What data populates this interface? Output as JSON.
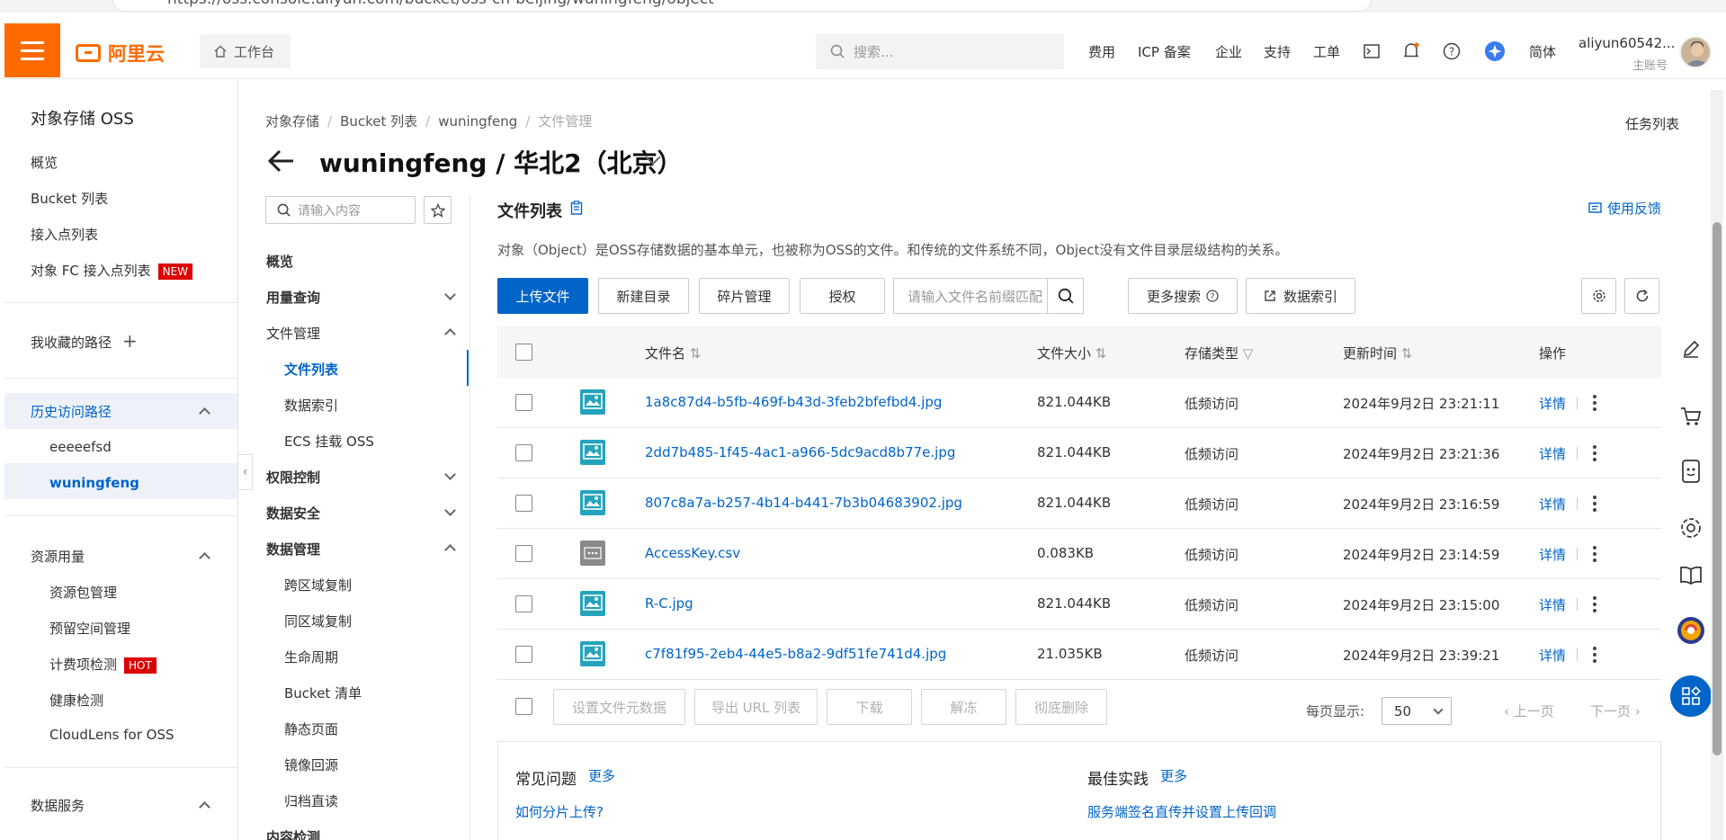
{
  "browser": {
    "url": "https://oss.console.aliyun.com/bucket/oss-cn-beijing/wuningfeng/object"
  },
  "header": {
    "logo_text": "阿里云",
    "workbench": "工作台",
    "search_placeholder": "搜索...",
    "nav": [
      "费用",
      "ICP 备案",
      "企业",
      "支持",
      "工单"
    ],
    "lang": "简体",
    "account": "aliyun60542...",
    "account_sub": "主账号"
  },
  "sidebar": {
    "title": "对象存储 OSS",
    "items": [
      "概览",
      "Bucket 列表",
      "接入点列表",
      "对象 FC 接入点列表"
    ],
    "fc_badge": "NEW",
    "favorites": "我收藏的路径",
    "history": {
      "label": "历史访问路径",
      "items": [
        "eeeeefsd",
        "wuningfeng"
      ]
    },
    "resource": {
      "label": "资源用量",
      "items": [
        "资源包管理",
        "预留空间管理",
        "计费项检测",
        "健康检测",
        "CloudLens for OSS"
      ],
      "hot_badge": "HOT"
    },
    "data_service": "数据服务"
  },
  "breadcrumb": [
    "对象存储",
    "Bucket 列表",
    "wuningfeng",
    "文件管理"
  ],
  "task_list": "任务列表",
  "page_title": "wuningfeng / 华北2（北京）",
  "secondary_nav": {
    "search_placeholder": "请输入内容",
    "overview": "概览",
    "usage": "用量查询",
    "file_mgmt": "文件管理",
    "file_sub": [
      "文件列表",
      "数据索引",
      "ECS 挂载 OSS"
    ],
    "perm": "权限控制",
    "security": "数据安全",
    "data_mgmt": "数据管理",
    "data_sub": [
      "跨区域复制",
      "同区域复制",
      "生命周期",
      "Bucket 清单",
      "静态页面",
      "镜像回源",
      "归档直读"
    ],
    "content": "内容检测"
  },
  "main": {
    "title": "文件列表",
    "feedback": "使用反馈",
    "description": "对象（Object）是OSS存储数据的基本单元，也被称为OSS的文件。和传统的文件系统不同，Object没有文件目录层级结构的关系。",
    "buttons": {
      "upload": "上传文件",
      "new_dir": "新建目录",
      "fragments": "碎片管理",
      "auth": "授权",
      "more_search": "更多搜索",
      "data_index": "数据索引"
    },
    "file_search_placeholder": "请输入文件名前缀匹配",
    "columns": [
      "文件名",
      "文件大小",
      "存储类型",
      "更新时间",
      "操作"
    ],
    "rows": [
      {
        "name": "1a8c87d4-b5fb-469f-b43d-3feb2bfefbd4.jpg",
        "size": "821.044KB",
        "type": "低频访问",
        "time": "2024年9月2日 23:21:11",
        "action": "详情",
        "kind": "img"
      },
      {
        "name": "2dd7b485-1f45-4ac1-a966-5dc9acd8b77e.jpg",
        "size": "821.044KB",
        "type": "低频访问",
        "time": "2024年9月2日 23:21:36",
        "action": "详情",
        "kind": "img"
      },
      {
        "name": "807c8a7a-b257-4b14-b441-7b3b04683902.jpg",
        "size": "821.044KB",
        "type": "低频访问",
        "time": "2024年9月2日 23:16:59",
        "action": "详情",
        "kind": "img"
      },
      {
        "name": "AccessKey.csv",
        "size": "0.083KB",
        "type": "低频访问",
        "time": "2024年9月2日 23:14:59",
        "action": "详情",
        "kind": "csv"
      },
      {
        "name": "R-C.jpg",
        "size": "821.044KB",
        "type": "低频访问",
        "time": "2024年9月2日 23:15:00",
        "action": "详情",
        "kind": "img"
      },
      {
        "name": "c7f81f95-2eb4-44e5-b8a2-9df51fe741d4.jpg",
        "size": "21.035KB",
        "type": "低频访问",
        "time": "2024年9月2日 23:39:21",
        "action": "详情",
        "kind": "img"
      }
    ],
    "batch": [
      "设置文件元数据",
      "导出 URL 列表",
      "下载",
      "解冻",
      "彻底删除"
    ],
    "pager": {
      "label": "每页显示:",
      "size": "50",
      "prev": "上一页",
      "next": "下一页"
    }
  },
  "faq": {
    "title": "常见问题",
    "more": "更多",
    "link": "如何分片上传?"
  },
  "best": {
    "title": "最佳实践",
    "more": "更多",
    "link": "服务端签名直传并设置上传回调"
  },
  "colors": {
    "primary": "#0064c8",
    "brand": "#ff6a00",
    "badge": "#dd0000"
  }
}
